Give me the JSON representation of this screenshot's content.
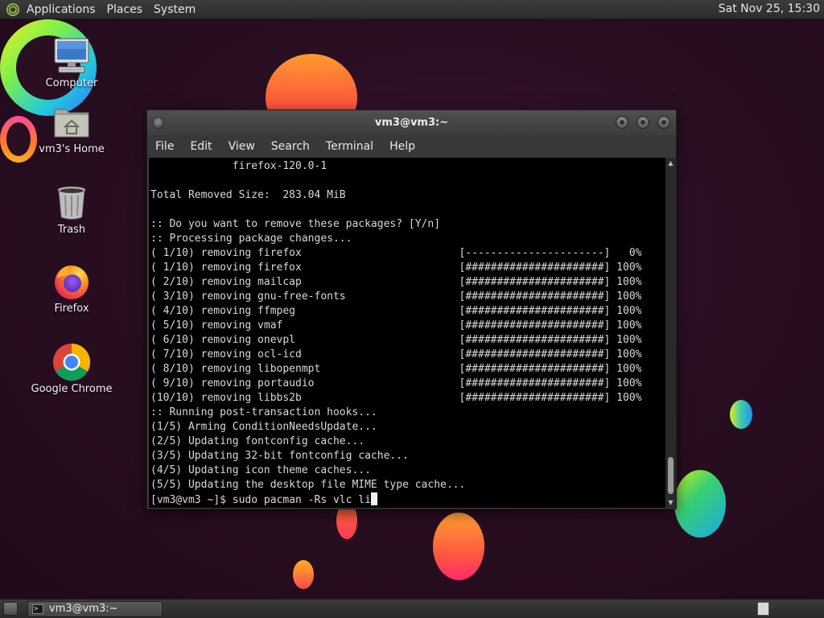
{
  "top_panel": {
    "menus": [
      "Applications",
      "Places",
      "System"
    ],
    "clock": "Sat Nov 25, 15:30"
  },
  "desktop_icons": [
    {
      "label": "Computer",
      "icon": "computer-icon"
    },
    {
      "label": "vm3's Home",
      "icon": "home-folder-icon"
    },
    {
      "label": "Trash",
      "icon": "trash-icon"
    },
    {
      "label": "Firefox",
      "icon": "firefox-icon"
    },
    {
      "label": "Google Chrome",
      "icon": "chrome-icon"
    }
  ],
  "terminal": {
    "title": "vm3@vm3:~",
    "menu": [
      "File",
      "Edit",
      "View",
      "Search",
      "Terminal",
      "Help"
    ],
    "lines": [
      "             firefox-120.0-1",
      "",
      "Total Removed Size:  283.04 MiB",
      "",
      ":: Do you want to remove these packages? [Y/n]",
      ":: Processing package changes...",
      "( 1/10) removing firefox                         [----------------------]   0%",
      "( 1/10) removing firefox                         [######################] 100%",
      "( 2/10) removing mailcap                         [######################] 100%",
      "( 3/10) removing gnu-free-fonts                  [######################] 100%",
      "( 4/10) removing ffmpeg                          [######################] 100%",
      "( 5/10) removing vmaf                            [######################] 100%",
      "( 6/10) removing onevpl                          [######################] 100%",
      "( 7/10) removing ocl-icd                         [######################] 100%",
      "( 8/10) removing libopenmpt                      [######################] 100%",
      "( 9/10) removing portaudio                       [######################] 100%",
      "(10/10) removing libbs2b                         [######################] 100%",
      ":: Running post-transaction hooks...",
      "(1/5) Arming ConditionNeedsUpdate...",
      "(2/5) Updating fontconfig cache...",
      "(3/5) Updating 32-bit fontconfig cache...",
      "(4/5) Updating icon theme caches...",
      "(5/5) Updating the desktop file MIME type cache..."
    ],
    "prompt": "[vm3@vm3 ~]$ sudo pacman -Rs vlc li"
  },
  "bottom_panel": {
    "task_label": "vm3@vm3:~"
  }
}
